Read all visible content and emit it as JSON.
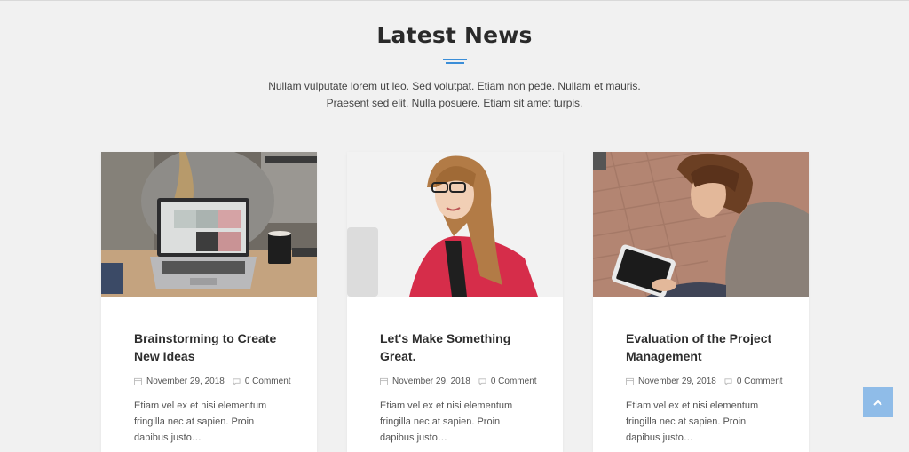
{
  "section": {
    "title": "Latest News",
    "subtitle_line1": "Nullam vulputate lorem ut leo. Sed volutpat. Etiam non pede. Nullam et mauris.",
    "subtitle_line2": "Praesent sed elit. Nulla posuere. Etiam sit amet turpis."
  },
  "posts": [
    {
      "title": "Brainstorming to Create New Ideas",
      "date": "November 29, 2018",
      "comments": "0 Comment",
      "excerpt": "Etiam vel ex et nisi elementum fringilla nec at sapien. Proin dapibus justo…"
    },
    {
      "title": "Let's Make Something Great.",
      "date": "November 29, 2018",
      "comments": "0 Comment",
      "excerpt": "Etiam vel ex et nisi elementum fringilla nec at sapien. Proin dapibus justo…"
    },
    {
      "title": "Evaluation of the Project Management",
      "date": "November 29, 2018",
      "comments": "0 Comment",
      "excerpt": "Etiam vel ex et nisi elementum fringilla nec at sapien. Proin dapibus justo…"
    }
  ],
  "icons": {
    "calendar": "calendar-icon",
    "comment": "comment-icon",
    "scroll_top": "chevron-up-icon"
  },
  "colors": {
    "accent": "#3b8ed8",
    "scroll_top_bg": "#8fbce8",
    "background": "#f1f1f1"
  }
}
